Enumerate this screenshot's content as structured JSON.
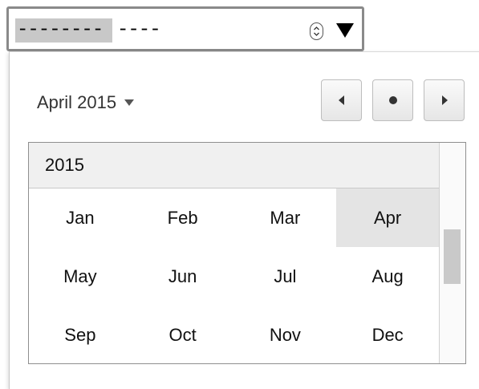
{
  "input": {
    "month_placeholder": "---------",
    "year_placeholder": "----"
  },
  "icons": {
    "stepper": "up-down-stepper-icon",
    "dropdown": "triangle-down-icon",
    "month_caret": "caret-down-icon",
    "prev": "triangle-left-icon",
    "today": "dot-icon",
    "next": "triangle-right-icon"
  },
  "picker": {
    "month_year_label": "April 2015",
    "year": "2015",
    "selected_month": "Apr",
    "months": [
      "Jan",
      "Feb",
      "Mar",
      "Apr",
      "May",
      "Jun",
      "Jul",
      "Aug",
      "Sep",
      "Oct",
      "Nov",
      "Dec"
    ]
  },
  "colors": {
    "selected_bg": "#e4e4e4",
    "header_bg": "#f0f0f0",
    "field_border": "#8a8a8a"
  }
}
